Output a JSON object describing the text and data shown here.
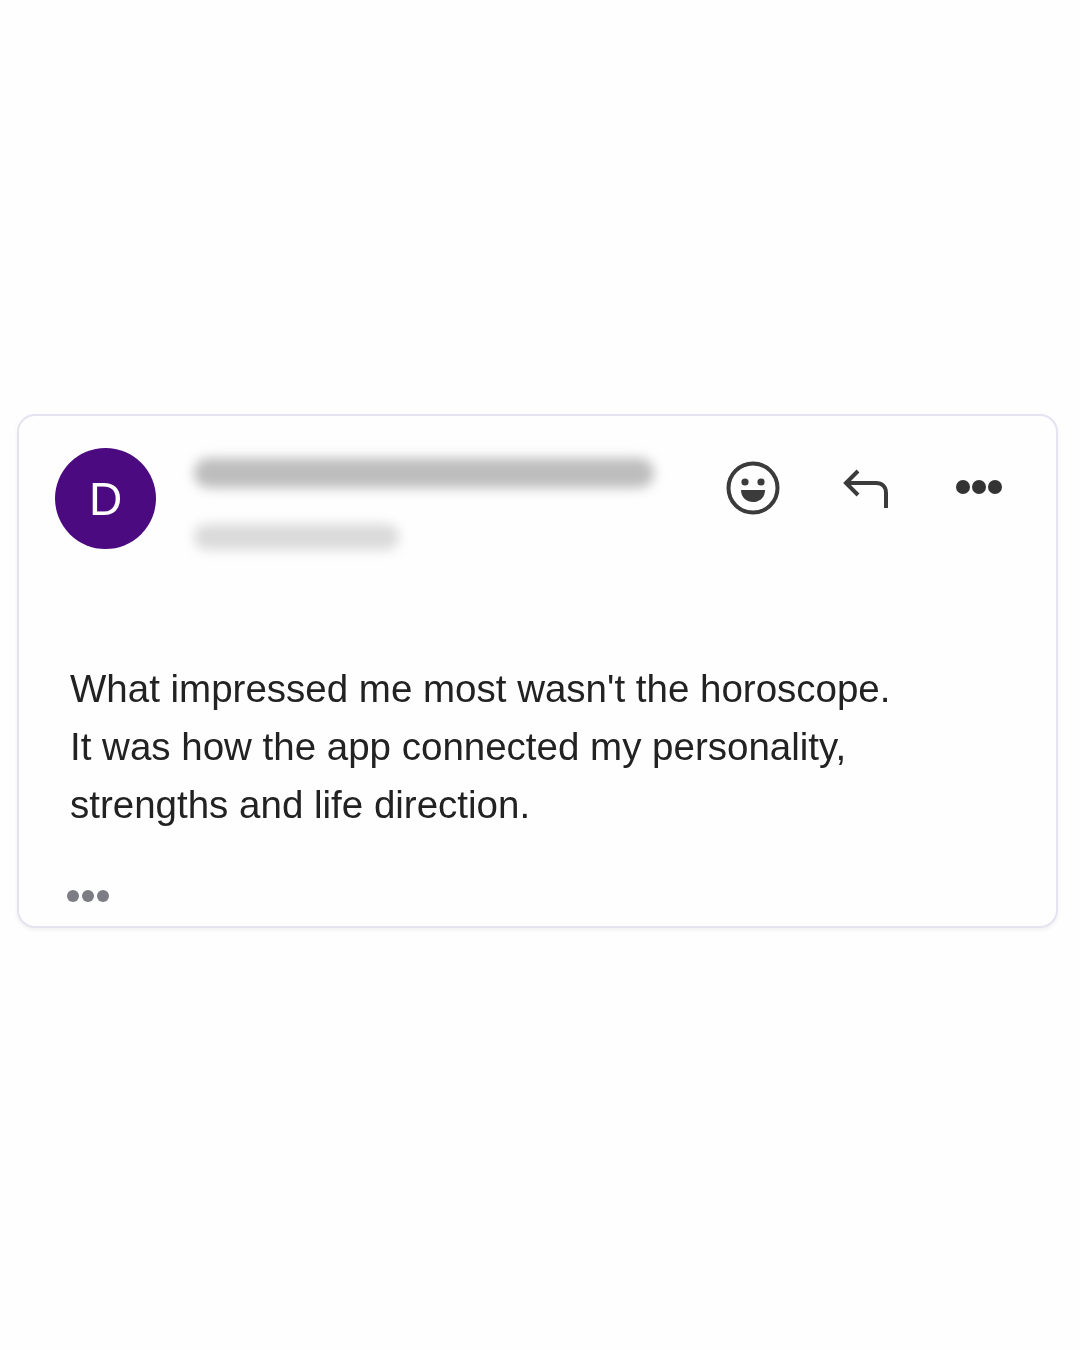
{
  "email": {
    "avatar_initial": "D",
    "body_lines": [
      "What impressed me most wasn't the horoscope.",
      "It was how the app connected my personality,",
      "strengths and life direction."
    ]
  }
}
